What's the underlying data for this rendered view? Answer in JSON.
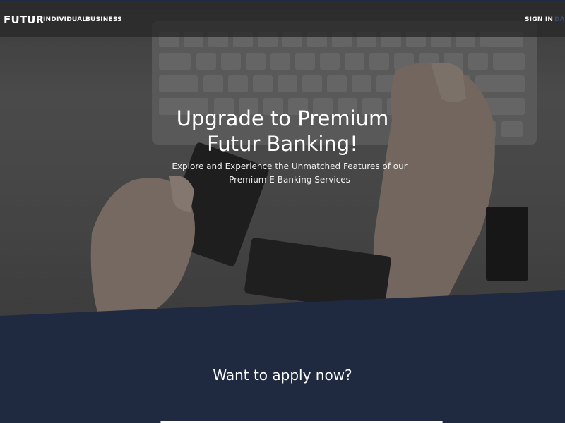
{
  "nav": {
    "logo": "FUTUR",
    "links": [
      {
        "label": "INDIVIDUAL"
      },
      {
        "label": "BUSINESS"
      }
    ],
    "sign_in": "SIGN IN",
    "extra": "DA"
  },
  "hero": {
    "title_line1": "Upgrade to Premium",
    "title_line2": "Futur Banking!",
    "subtitle": "Explore and Experience the Unmatched Features of our Premium E-Banking Services"
  },
  "apply": {
    "title": "Want to apply now?"
  },
  "colors": {
    "brand_dark": "#1f2940",
    "text": "#ffffff"
  }
}
